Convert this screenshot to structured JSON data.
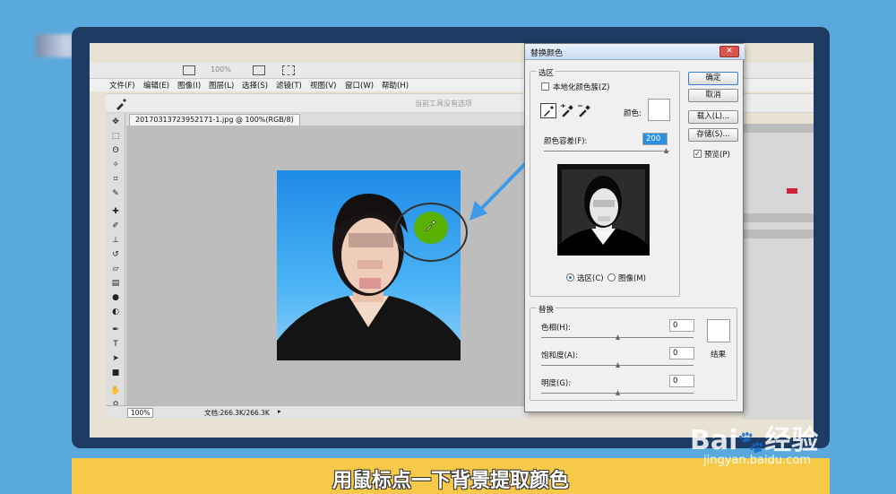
{
  "colors": {
    "accent": "#2a8fe0",
    "arrow": "#3c9be8",
    "green": "#58b000",
    "caption_bg": "#f7c948",
    "photo_bg": "#1e8be8"
  },
  "ps": {
    "zoom_top": "100%",
    "menu": [
      "文件(F)",
      "编辑(E)",
      "图像(I)",
      "图层(L)",
      "选择(S)",
      "滤镜(T)",
      "视图(V)",
      "窗口(W)",
      "帮助(H)"
    ],
    "options_hint": "当前工具没有选项",
    "doc_tab": "20170313723952171-1.jpg @ 100%(RGB/8)",
    "status_zoom": "100%",
    "status_doc": "文档:266.3K/266.3K",
    "tool_icons": [
      "move-icon",
      "marquee-icon",
      "lasso-icon",
      "magic-wand-icon",
      "crop-icon",
      "eyedropper-icon",
      "healing-icon",
      "brush-icon",
      "stamp-icon",
      "history-brush-icon",
      "eraser-icon",
      "gradient-icon",
      "blur-icon",
      "dodge-icon",
      "pen-icon",
      "type-icon",
      "path-select-icon",
      "shape-icon",
      "hand-icon",
      "zoom-icon"
    ]
  },
  "dialog": {
    "title": "替换颜色",
    "selection_group": "选区",
    "localized_clusters": "本地化颜色簇(Z)",
    "color_label": "颜色:",
    "fuzziness_label": "颜色容差(F):",
    "fuzziness_value": "200",
    "radio_selection": "选区(C)",
    "radio_image": "图像(M)",
    "replace_group": "替换",
    "hue_label": "色相(H):",
    "hue_value": "0",
    "sat_label": "饱和度(A):",
    "sat_value": "0",
    "light_label": "明度(G):",
    "light_value": "0",
    "result_label": "结果",
    "buttons": {
      "ok": "确定",
      "cancel": "取消",
      "load": "载入(L)...",
      "save": "存储(S)...",
      "preview": "预览(P)"
    }
  },
  "caption": "用鼠标点一下背景提取颜色",
  "watermark": {
    "brand": "Bai",
    "brand2": "经验",
    "url": "jingyan.baidu.com"
  }
}
